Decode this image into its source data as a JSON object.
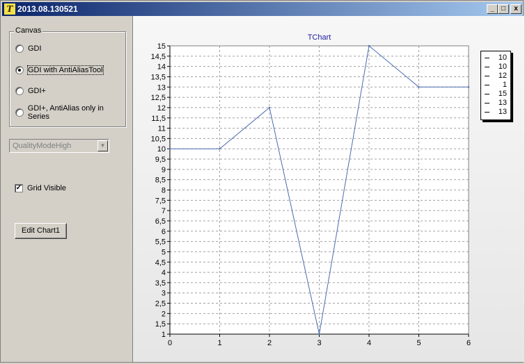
{
  "window": {
    "title": "2013.08.130521",
    "icon": "teechart-app-icon"
  },
  "window_controls": {
    "minimize": "_",
    "maximize": "□",
    "close": "x"
  },
  "canvas_group": {
    "label": "Canvas",
    "options": [
      {
        "label": "GDI",
        "checked": false
      },
      {
        "label": "GDI with AntiAliasTool",
        "checked": true
      },
      {
        "label": "GDI+",
        "checked": false
      },
      {
        "label": "GDI+, AntiAlias only in Series",
        "checked": false
      }
    ]
  },
  "quality_combo": {
    "value": "QualityModeHigh",
    "enabled": false
  },
  "grid_visible": {
    "label": "Grid Visible",
    "checked": true,
    "mark": "✓"
  },
  "edit_button": {
    "label": "Edit Chart1"
  },
  "legend": {
    "items": [
      "10",
      "10",
      "12",
      "1",
      "15",
      "13",
      "13"
    ]
  },
  "chart_data": {
    "type": "line",
    "title": "TChart",
    "x": [
      0,
      1,
      2,
      3,
      4,
      5,
      6
    ],
    "series": [
      {
        "values": [
          10,
          10,
          12,
          1,
          15,
          13,
          13
        ],
        "color": "#4a6bb0"
      }
    ],
    "xlim": [
      0,
      6
    ],
    "ylim": [
      1,
      15
    ],
    "x_ticks": [
      "0",
      "1",
      "2",
      "3",
      "4",
      "5",
      "6"
    ],
    "y_ticks": [
      "1",
      "1,5",
      "2",
      "2,5",
      "3",
      "3,5",
      "4",
      "4,5",
      "5",
      "5,5",
      "6",
      "6,5",
      "7",
      "7,5",
      "8",
      "8,5",
      "9",
      "9,5",
      "10",
      "10,5",
      "11",
      "11,5",
      "12",
      "12,5",
      "13",
      "13,5",
      "14",
      "14,5",
      "15"
    ],
    "grid": true,
    "legend_position": "right"
  }
}
